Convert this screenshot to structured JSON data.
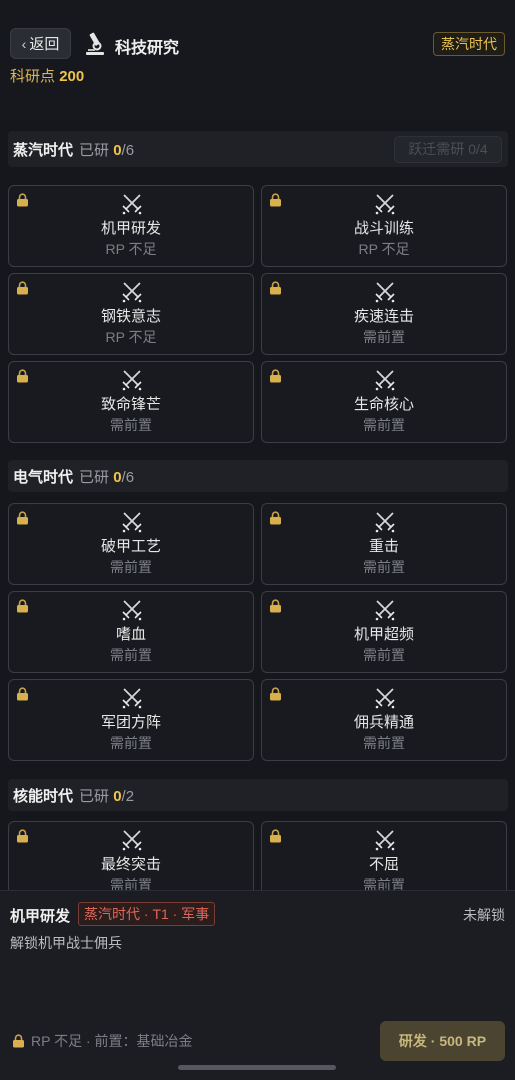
{
  "header": {
    "back_label": "返回",
    "title": "科技研究",
    "era_badge": "蒸汽时代",
    "rp_label": "科研点",
    "rp_value": "200"
  },
  "sections": [
    {
      "name": "蒸汽时代",
      "done_label": "已研",
      "done": "0",
      "total": "/6",
      "leap_button": "跃迁需研 0/4",
      "techs": [
        {
          "name": "机甲研发",
          "state": "RP 不足"
        },
        {
          "name": "战斗训练",
          "state": "RP 不足"
        },
        {
          "name": "钢铁意志",
          "state": "RP 不足"
        },
        {
          "name": "疾速连击",
          "state": "需前置"
        },
        {
          "name": "致命锋芒",
          "state": "需前置"
        },
        {
          "name": "生命核心",
          "state": "需前置"
        }
      ]
    },
    {
      "name": "电气时代",
      "done_label": "已研",
      "done": "0",
      "total": "/6",
      "techs": [
        {
          "name": "破甲工艺",
          "state": "需前置"
        },
        {
          "name": "重击",
          "state": "需前置"
        },
        {
          "name": "嗜血",
          "state": "需前置"
        },
        {
          "name": "机甲超频",
          "state": "需前置"
        },
        {
          "name": "军团方阵",
          "state": "需前置"
        },
        {
          "name": "佣兵精通",
          "state": "需前置"
        }
      ]
    },
    {
      "name": "核能时代",
      "done_label": "已研",
      "done": "0",
      "total": "/2",
      "techs": [
        {
          "name": "最终突击",
          "state": "需前置"
        },
        {
          "name": "不屈",
          "state": "需前置"
        }
      ]
    }
  ],
  "detail": {
    "name": "机甲研发",
    "tag": "蒸汽时代 · T1 · 军事",
    "status": "未解锁",
    "description": "解锁机甲战士佣兵",
    "requirement": "RP 不足 · 前置：基础冶金",
    "research_button": "研发 · 500 RP"
  },
  "colors": {
    "accent_gold": "#f0c34a",
    "tag_red": "#e0665a",
    "background": "#15171c"
  }
}
